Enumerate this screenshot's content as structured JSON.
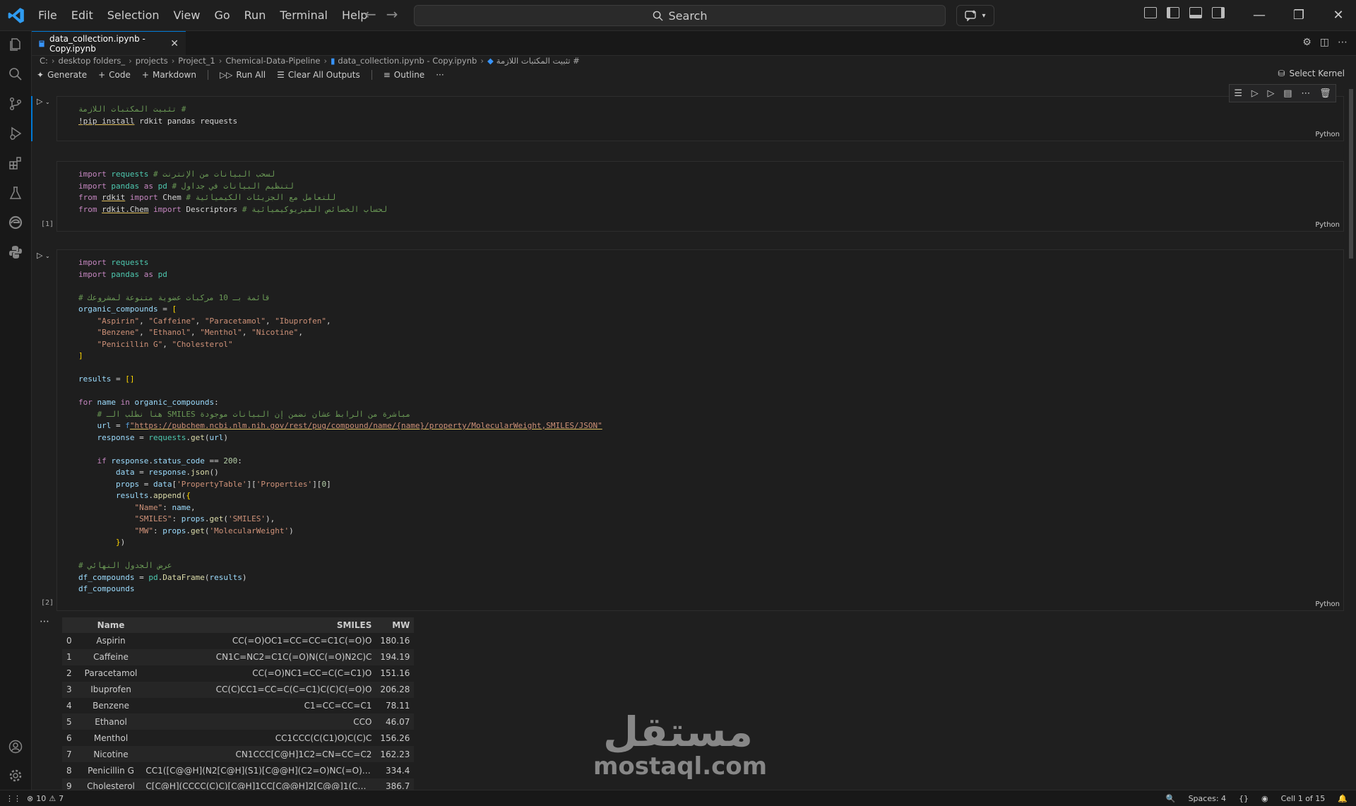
{
  "menu": [
    "File",
    "Edit",
    "Selection",
    "View",
    "Go",
    "Run",
    "Terminal",
    "Help"
  ],
  "search": {
    "label": "Search"
  },
  "tab": {
    "title": "data_collection.ipynb - Copy.ipynb"
  },
  "breadcrumb": [
    "C:",
    "desktop folders_",
    "projects",
    "Project_1",
    "Chemical-Data-Pipeline",
    "data_collection.ipynb - Copy.ipynb",
    "# تثبيت المكتبات اللازمة"
  ],
  "toolbar": {
    "generate": "Generate",
    "code": "Code",
    "markdown": "Markdown",
    "run_all": "Run All",
    "clear_outputs": "Clear All Outputs",
    "outline": "Outline",
    "more": "···",
    "select_kernel": "Select Kernel"
  },
  "cells": {
    "lang": "Python",
    "cell2_count": "[1]",
    "cell3_count": "[2]"
  },
  "code": {
    "c1": [
      "# تثبيت المكتبات اللازمة",
      "!pip install rdkit pandas requests"
    ],
    "c2_comments": [
      "# لسحب البيانات من الإنترنت",
      "# لتنظيم البيانات في جداول",
      "# للتعامل مع الجزيئات الكيميائية",
      "# لحساب الخصائص الفيزيوكيميائية"
    ],
    "c3_comment1": "# قائمة بـ 10 مركبات عضوية متنوعة لمشروعك",
    "c3_comment2": "# هنا نطلب الـ SMILES مباشرة من الرابط عشان نضمن إن البيانات موجودة",
    "c3_comment3": "# عرض الجدول النهائي",
    "url": "\"https://pubchem.ncbi.nlm.nih.gov/rest/pug/compound/name/{name}/property/MolecularWeight,SMILES/JSON\""
  },
  "table": {
    "headers": [
      "",
      "Name",
      "SMILES",
      "MW"
    ],
    "rows": [
      [
        "0",
        "Aspirin",
        "CC(=O)OC1=CC=CC=C1C(=O)O",
        "180.16"
      ],
      [
        "1",
        "Caffeine",
        "CN1C=NC2=C1C(=O)N(C(=O)N2C)C",
        "194.19"
      ],
      [
        "2",
        "Paracetamol",
        "CC(=O)NC1=CC=C(C=C1)O",
        "151.16"
      ],
      [
        "3",
        "Ibuprofen",
        "CC(C)CC1=CC=C(C=C1)C(C)C(=O)O",
        "206.28"
      ],
      [
        "4",
        "Benzene",
        "C1=CC=CC=C1",
        "78.11"
      ],
      [
        "5",
        "Ethanol",
        "CCO",
        "46.07"
      ],
      [
        "6",
        "Menthol",
        "CC1CCC(C(C1)O)C(C)C",
        "156.26"
      ],
      [
        "7",
        "Nicotine",
        "CN1CCC[C@H]1C2=CN=CC=C2",
        "162.23"
      ],
      [
        "8",
        "Penicillin G",
        "CC1([C@@H](N2[C@H](S1)[C@@H](C2=O)NC(=O)CC3=CC...",
        "334.4"
      ],
      [
        "9",
        "Cholesterol",
        "C[C@H](CCCC(C)C)[C@H]1CC[C@@H]2[C@@]1(CC[C@H]3...",
        "386.7"
      ]
    ]
  },
  "watermark": {
    "arabic": "مستقل",
    "latin": "mostaql.com"
  },
  "status": {
    "errors": "10",
    "warnings": "7",
    "spaces": "Spaces: 4",
    "braces": "{}",
    "cell": "Cell 1 of 15"
  }
}
